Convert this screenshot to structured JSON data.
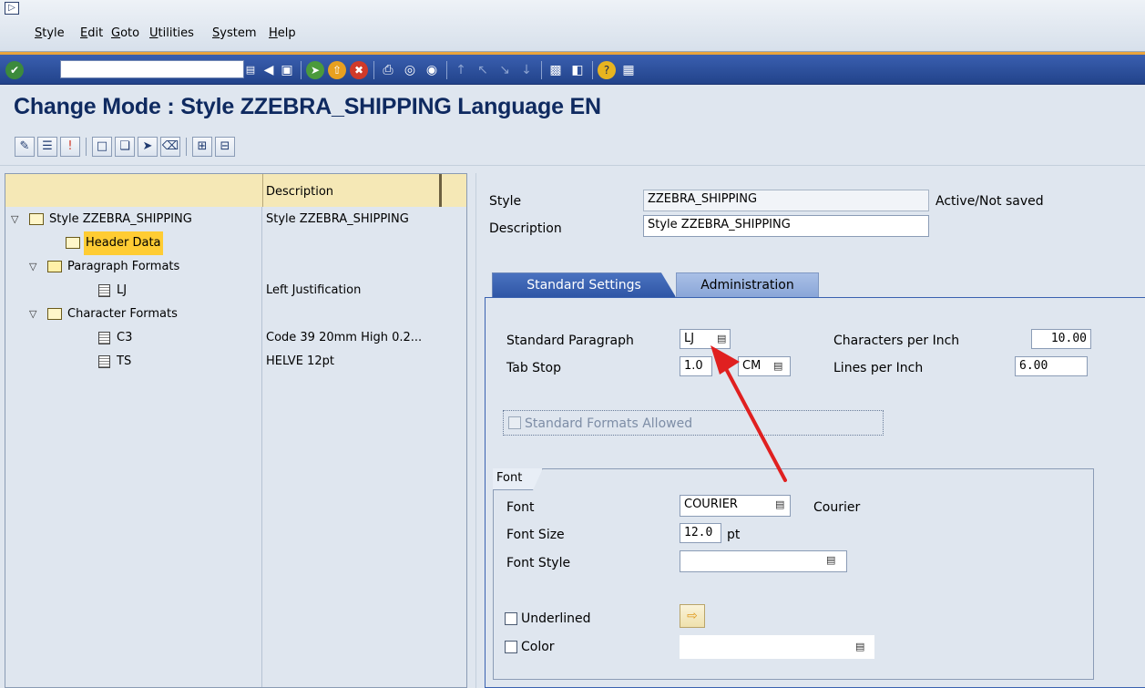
{
  "menu": {
    "items": [
      "Style",
      "Edit",
      "Goto",
      "Utilities",
      "System",
      "Help"
    ]
  },
  "toolbar": {
    "command_value": ""
  },
  "page": {
    "title": "Change Mode : Style ZZEBRA_SHIPPING Language EN"
  },
  "tree": {
    "header_description": "Description",
    "rows": [
      {
        "label": "Style ZZEBRA_SHIPPING",
        "description": "Style ZZEBRA_SHIPPING"
      },
      {
        "label": "Header Data",
        "description": ""
      },
      {
        "label": "Paragraph Formats",
        "description": ""
      },
      {
        "label": "LJ",
        "description": "Left Justification"
      },
      {
        "label": "Character Formats",
        "description": ""
      },
      {
        "label": "C3",
        "description": "Code 39 20mm High 0.2..."
      },
      {
        "label": "TS",
        "description": "HELVE 12pt"
      }
    ]
  },
  "header": {
    "style_label": "Style",
    "style_value": "ZZEBRA_SHIPPING",
    "status": "Active/Not saved",
    "description_label": "Description",
    "description_value": "Style ZZEBRA_SHIPPING"
  },
  "tabs": {
    "standard": "Standard Settings",
    "administration": "Administration"
  },
  "standard": {
    "paragraph_label": "Standard Paragraph",
    "paragraph_value": "LJ",
    "tabstop_label": "Tab Stop",
    "tabstop_value": "1.0",
    "tabstop_unit": "CM",
    "cpi_label": "Characters per Inch",
    "cpi_value": "10.00",
    "lpi_label": "Lines per Inch",
    "lpi_value": "6.00",
    "formats_allowed_label": "Standard Formats Allowed"
  },
  "font": {
    "group_title": "Font",
    "font_label": "Font",
    "font_value": "COURIER",
    "font_desc": "Courier",
    "size_label": "Font Size",
    "size_value": "12.0",
    "size_unit": "pt",
    "style_label": "Font Style",
    "style_value": "",
    "underlined_label": "Underlined",
    "color_label": "Color",
    "color_value": ""
  },
  "colors": {
    "toolbar_blue": "#22438a",
    "title_blue": "#0f2a60",
    "tab_active": "#2f56a6",
    "selection": "#ffcc33",
    "arrow": "#e02020"
  }
}
